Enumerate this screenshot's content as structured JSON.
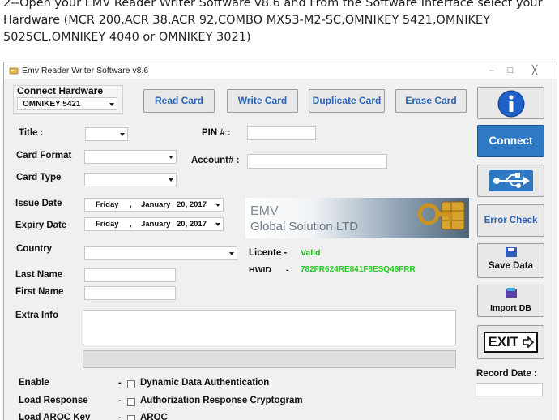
{
  "instructions": {
    "line1": "2--Open your EMV Reader Writer Software v8.6 and From the Software Interface select your",
    "line2": "Hardware (MCR 200,ACR 38,ACR 92,COMBO MX53-M2-SC,OMNIKEY 5421,OMNIKEY",
    "line3": "5025CL,OMNIKEY 4040 or OMNIKEY 3021)"
  },
  "window": {
    "title": "Emv Reader Writer Software v8.6",
    "minimize": "–",
    "restore": "□",
    "close": "╳"
  },
  "hardware": {
    "label": "Connect Hardware",
    "selected": "OMNIKEY 5421"
  },
  "toolbar": {
    "read_card": "Read Card",
    "write_card": "Write Card",
    "duplicate_card": "Duplicate Card",
    "erase_card": "Erase Card"
  },
  "form": {
    "title_label": "Title :",
    "title_value": "",
    "pin_label": "PIN # :",
    "pin_value": "",
    "card_format_label": "Card Format",
    "card_format_value": "",
    "account_label": "Account# :",
    "account_value": "",
    "card_type_label": "Card Type",
    "card_type_value": "",
    "issue_date_label": "Issue Date",
    "issue_date": {
      "weekday": "Friday",
      "month": "January",
      "day": "20, 2017"
    },
    "expiry_date_label": "Expiry Date",
    "expiry_date": {
      "weekday": "Friday",
      "month": "January",
      "day": "20, 2017"
    },
    "date_sep": ",",
    "country_label": "Country",
    "country_value": "",
    "last_name_label": "Last Name",
    "last_name_value": "",
    "first_name_label": "First Name",
    "first_name_value": "",
    "extra_info_label": "Extra Info",
    "extra_info_value": ""
  },
  "banner": {
    "line1": "EMV",
    "line2": "Global Solution LTD"
  },
  "license": {
    "licente_label": "Licente -",
    "licente_value": "Valid",
    "hwid_label": "HWID",
    "hwid_sep": "-",
    "hwid_value": "782FR624RE841F8ESQ48FRR"
  },
  "side": {
    "connect": "Connect",
    "error_check": "Error Check",
    "save_data": "Save Data",
    "import_db": "Import DB",
    "exit": "EXIT",
    "record_date_label": "Record Date :",
    "record_date_value": ""
  },
  "options": [
    {
      "label": "Enable",
      "dash": "-",
      "checkbox_label": "Dynamic Data Authentication",
      "checked": false
    },
    {
      "label": "Load Response",
      "dash": "-",
      "checkbox_label": "Authorization Response Cryptogram",
      "checked": false
    },
    {
      "label": "Load AROC Key",
      "dash": "-",
      "checkbox_label": "AROC",
      "checked": false
    }
  ],
  "colors": {
    "accent": "#2a64b4",
    "valid": "#22b522",
    "hwid": "#22cc22",
    "connect_bg": "#2f78c4"
  }
}
